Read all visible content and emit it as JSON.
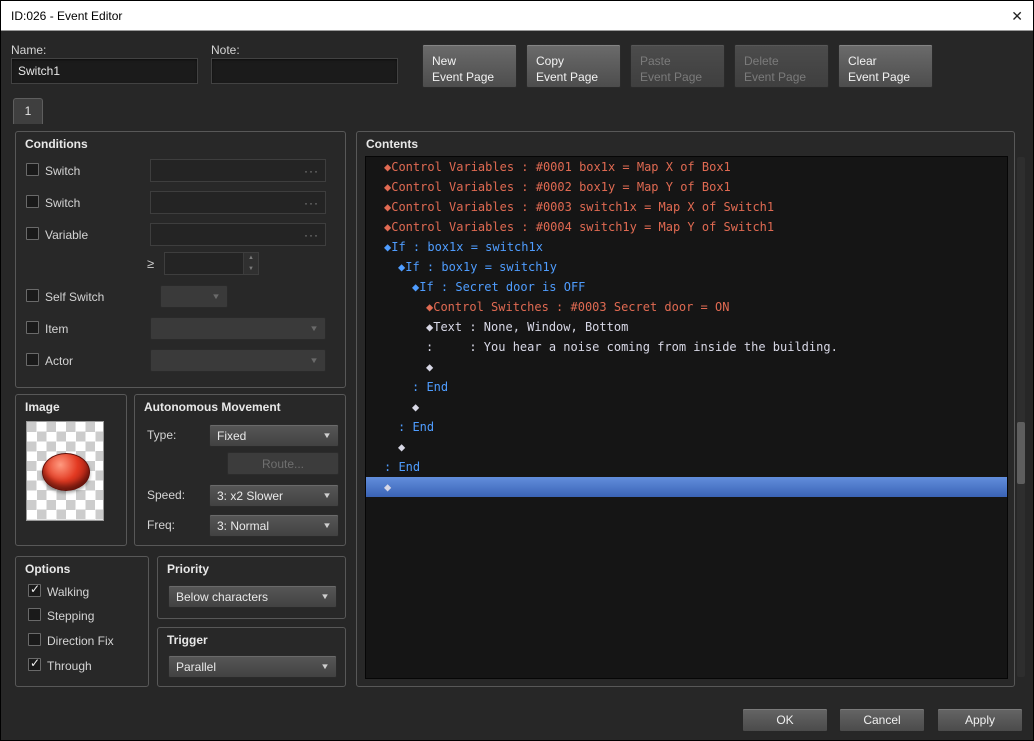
{
  "titlebar": {
    "title": "ID:026 - Event Editor",
    "close_icon": "✕"
  },
  "icons": {
    "dropdown_arrow": "▼",
    "spinner_up": "▲",
    "spinner_down": "▼",
    "browse_ellipsis": "···",
    "checkmark": "✓"
  },
  "header": {
    "name_label": "Name:",
    "name_value": "Switch1",
    "note_label": "Note:",
    "note_value": "",
    "page_buttons": [
      {
        "line1": "New",
        "line2": "Event Page",
        "disabled": false
      },
      {
        "line1": "Copy",
        "line2": "Event Page",
        "disabled": false
      },
      {
        "line1": "Paste",
        "line2": "Event Page",
        "disabled": true
      },
      {
        "line1": "Delete",
        "line2": "Event Page",
        "disabled": true
      },
      {
        "line1": "Clear",
        "line2": "Event Page",
        "disabled": false
      }
    ]
  },
  "tab": {
    "label": "1"
  },
  "conditions": {
    "title": "Conditions",
    "gte_symbol": "≥",
    "rows": {
      "switch1": {
        "label": "Switch",
        "checked": false,
        "value": ""
      },
      "switch2": {
        "label": "Switch",
        "checked": false,
        "value": ""
      },
      "variable": {
        "label": "Variable",
        "checked": false,
        "value": ""
      },
      "variable_amount": "",
      "self_switch": {
        "label": "Self Switch",
        "checked": false,
        "value": ""
      },
      "item": {
        "label": "Item",
        "checked": false,
        "value": ""
      },
      "actor": {
        "label": "Actor",
        "checked": false,
        "value": ""
      }
    }
  },
  "image": {
    "title": "Image"
  },
  "movement": {
    "title": "Autonomous Movement",
    "type_label": "Type:",
    "type_value": "Fixed",
    "route_label": "Route...",
    "speed_label": "Speed:",
    "speed_value": "3: x2 Slower",
    "freq_label": "Freq:",
    "freq_value": "3: Normal"
  },
  "options": {
    "title": "Options",
    "items": [
      {
        "label": "Walking",
        "checked": true
      },
      {
        "label": "Stepping",
        "checked": false
      },
      {
        "label": "Direction Fix",
        "checked": false
      },
      {
        "label": "Through",
        "checked": true
      }
    ]
  },
  "priority": {
    "title": "Priority",
    "value": "Below characters"
  },
  "trigger": {
    "title": "Trigger",
    "value": "Parallel"
  },
  "contents": {
    "title": "Contents",
    "lines": [
      {
        "indent": 0,
        "color": "red",
        "text": "◆Control Variables : #0001 box1x = Map X of Box1"
      },
      {
        "indent": 0,
        "color": "red",
        "text": "◆Control Variables : #0002 box1y = Map Y of Box1"
      },
      {
        "indent": 0,
        "color": "red",
        "text": "◆Control Variables : #0003 switch1x = Map X of Switch1"
      },
      {
        "indent": 0,
        "color": "red",
        "text": "◆Control Variables : #0004 switch1y = Map Y of Switch1"
      },
      {
        "indent": 0,
        "color": "blue",
        "text": "◆If : box1x = switch1x"
      },
      {
        "indent": 1,
        "color": "blue",
        "text": "◆If : box1y = switch1y"
      },
      {
        "indent": 2,
        "color": "blue",
        "text": "◆If : Secret door is OFF"
      },
      {
        "indent": 3,
        "color": "red",
        "text": "◆Control Switches : #0003 Secret door = ON"
      },
      {
        "indent": 3,
        "color": "white",
        "text": "◆Text : None, Window, Bottom"
      },
      {
        "indent": 3,
        "color": "white",
        "text": ":     : You hear a noise coming from inside the building."
      },
      {
        "indent": 3,
        "color": "white",
        "text": "◆"
      },
      {
        "indent": 2,
        "color": "blue",
        "text": ": End"
      },
      {
        "indent": 2,
        "color": "white",
        "text": "◆"
      },
      {
        "indent": 1,
        "color": "blue",
        "text": ": End"
      },
      {
        "indent": 1,
        "color": "white",
        "text": "◆"
      },
      {
        "indent": 0,
        "color": "blue",
        "text": ": End"
      },
      {
        "indent": 0,
        "color": "white",
        "text": "◆",
        "selected": true
      }
    ]
  },
  "footer": {
    "ok_label": "OK",
    "cancel_label": "Cancel",
    "apply_label": "Apply"
  },
  "colors": {
    "command_red": "#e06a52",
    "command_blue": "#4f9dff",
    "command_text": "#d8d8e6",
    "selection_top": "#628edc",
    "selection_bottom": "#3a63b5"
  }
}
